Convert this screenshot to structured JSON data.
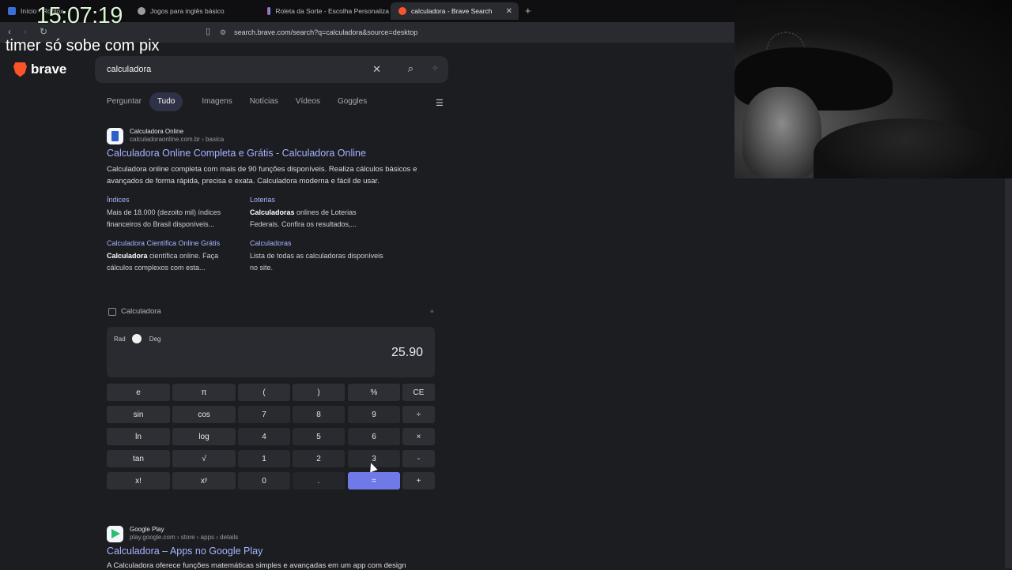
{
  "overlay": {
    "timer": "15:07:19",
    "caption": "timer só sobe com pix"
  },
  "browser": {
    "tabs": [
      {
        "title": "Início - Roblox",
        "active": false,
        "favicon_color": "#3a6fd8"
      },
      {
        "title": "Jogos para inglês básico",
        "active": false,
        "favicon_color": "#9a9a9a"
      },
      {
        "title": "Roleta da Sorte - Escolha Personaliza",
        "active": false,
        "favicon_color": "#e34c9e"
      },
      {
        "title": "calculadora - Brave Search",
        "active": true,
        "favicon_color": "#fb542b"
      }
    ],
    "new_tab_icon": "plus-icon",
    "close_tab_icon": "close-icon",
    "url": "search.brave.com/search?q=calculadora&source=desktop"
  },
  "page": {
    "brand": "brave",
    "search": {
      "query": "calculadora",
      "clear_icon": "close-icon",
      "search_icon": "search-icon",
      "ai_icon": "sparkle-icon"
    },
    "nav_tabs": [
      {
        "label": "Perguntar",
        "active": false
      },
      {
        "label": "Tudo",
        "active": true
      },
      {
        "label": "Imagens",
        "active": false
      },
      {
        "label": "Notícias",
        "active": false
      },
      {
        "label": "Vídeos",
        "active": false
      },
      {
        "label": "Goggles",
        "active": false
      }
    ],
    "result1": {
      "site": "Calculadora Online",
      "url": "calculadoraonline.com.br › basica",
      "title": "Calculadora Online Completa e Grátis - Calculadora Online",
      "description": "Calculadora online completa com mais de 90 funções disponíveis. Realiza cálculos básicos e avançados de forma rápida, precisa e exata. Calculadora moderna e fácil de usar.",
      "sublinks": [
        {
          "title": "Índices",
          "bold": "",
          "text": "Mais de 18.000 (dezoito mil) índices financeiros do Brasil disponíveis..."
        },
        {
          "title": "Loterias",
          "bold": "Calculadoras",
          "text": " onlines de Loterias Federais. Confira os resultados,..."
        },
        {
          "title": "Calculadora Científica Online Grátis",
          "bold": "Calculadora",
          "text": " científica online. Faça cálculos complexos com esta..."
        },
        {
          "title": "Calculadoras",
          "bold": "",
          "text": "Lista de todas as calculadoras disponíveis no site."
        }
      ]
    },
    "calculator": {
      "heading": "Calculadora",
      "mode_left": "Rad",
      "mode_right": "Deg",
      "display": "25.90",
      "keys": [
        [
          "e",
          "π",
          "(",
          ")",
          "%",
          "CE"
        ],
        [
          "sin",
          "cos",
          "7",
          "8",
          "9",
          "÷"
        ],
        [
          "ln",
          "log",
          "4",
          "5",
          "6",
          "×"
        ],
        [
          "tan",
          "√",
          "1",
          "2",
          "3",
          "-"
        ],
        [
          "x!",
          "xʸ",
          "0",
          ".",
          "=",
          "+"
        ]
      ]
    },
    "result2": {
      "site": "Google Play",
      "url": "play.google.com › store › apps › details",
      "title": "Calculadora – Apps no Google Play",
      "description": "A Calculadora oferece funções matemáticas simples e avançadas em um app com design"
    }
  }
}
